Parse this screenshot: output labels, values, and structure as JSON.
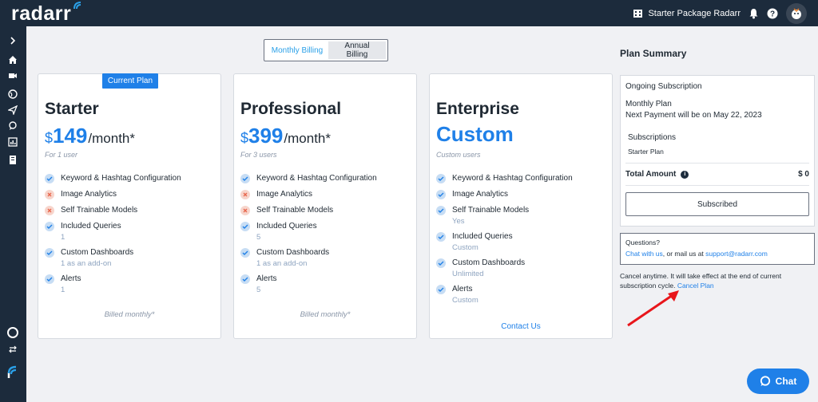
{
  "app": {
    "logo_text": "radarr"
  },
  "topbar": {
    "org_name": "Starter Package Radarr"
  },
  "billing_toggle": {
    "monthly": "Monthly Billing",
    "annual": "Annual Billing"
  },
  "plans": [
    {
      "badge": "Current Plan",
      "name": "Starter",
      "currency": "$",
      "price": "149",
      "period": "/month*",
      "users": "For 1 user",
      "features": [
        {
          "label": "Keyword & Hashtag Configuration",
          "included": true,
          "sub": ""
        },
        {
          "label": "Image Analytics",
          "included": false,
          "sub": ""
        },
        {
          "label": "Self Trainable Models",
          "included": false,
          "sub": ""
        },
        {
          "label": "Included Queries",
          "included": true,
          "sub": "1"
        },
        {
          "label": "Custom Dashboards",
          "included": true,
          "sub": "1 as an add-on"
        },
        {
          "label": "Alerts",
          "included": true,
          "sub": "1"
        }
      ],
      "footer": "Billed monthly*"
    },
    {
      "name": "Professional",
      "currency": "$",
      "price": "399",
      "period": "/month*",
      "users": "For 3 users",
      "features": [
        {
          "label": "Keyword & Hashtag Configuration",
          "included": true,
          "sub": ""
        },
        {
          "label": "Image Analytics",
          "included": false,
          "sub": ""
        },
        {
          "label": "Self Trainable Models",
          "included": false,
          "sub": ""
        },
        {
          "label": "Included Queries",
          "included": true,
          "sub": "5"
        },
        {
          "label": "Custom Dashboards",
          "included": true,
          "sub": "1 as an add-on"
        },
        {
          "label": "Alerts",
          "included": true,
          "sub": "5"
        }
      ],
      "footer": "Billed monthly*"
    },
    {
      "name": "Enterprise",
      "price_label": "Custom",
      "users": "Custom users",
      "features": [
        {
          "label": "Keyword & Hashtag Configuration",
          "included": true,
          "sub": ""
        },
        {
          "label": "Image Analytics",
          "included": true,
          "sub": ""
        },
        {
          "label": "Self Trainable Models",
          "included": true,
          "sub": "Yes"
        },
        {
          "label": "Included Queries",
          "included": true,
          "sub": "Custom"
        },
        {
          "label": "Custom Dashboards",
          "included": true,
          "sub": "Unlimited"
        },
        {
          "label": "Alerts",
          "included": true,
          "sub": "Custom"
        }
      ],
      "footer_link": "Contact Us"
    }
  ],
  "summary": {
    "title": "Plan Summary",
    "ongoing": "Ongoing Subscription",
    "plan": "Monthly Plan",
    "next_payment": "Next Payment will be on May 22, 2023",
    "subscriptions_title": "Subscriptions",
    "subscription_item": "Starter Plan",
    "total_label": "Total Amount",
    "total_value": "$ 0",
    "subscribed_button": "Subscribed"
  },
  "questions": {
    "title": "Questions?",
    "chat_link": "Chat with us",
    "middle_text": ", or mail us at ",
    "email_link": "support@radarr.com"
  },
  "cancel": {
    "text": "Cancel anytime. It will take effect at the end of current subscription cycle. ",
    "link": "Cancel Plan"
  },
  "chat": {
    "label": "Chat"
  },
  "colors": {
    "accent": "#1f80e8",
    "navy": "#1c2b3c",
    "error": "#e8674e",
    "annotation_arrow": "#e8161b"
  }
}
